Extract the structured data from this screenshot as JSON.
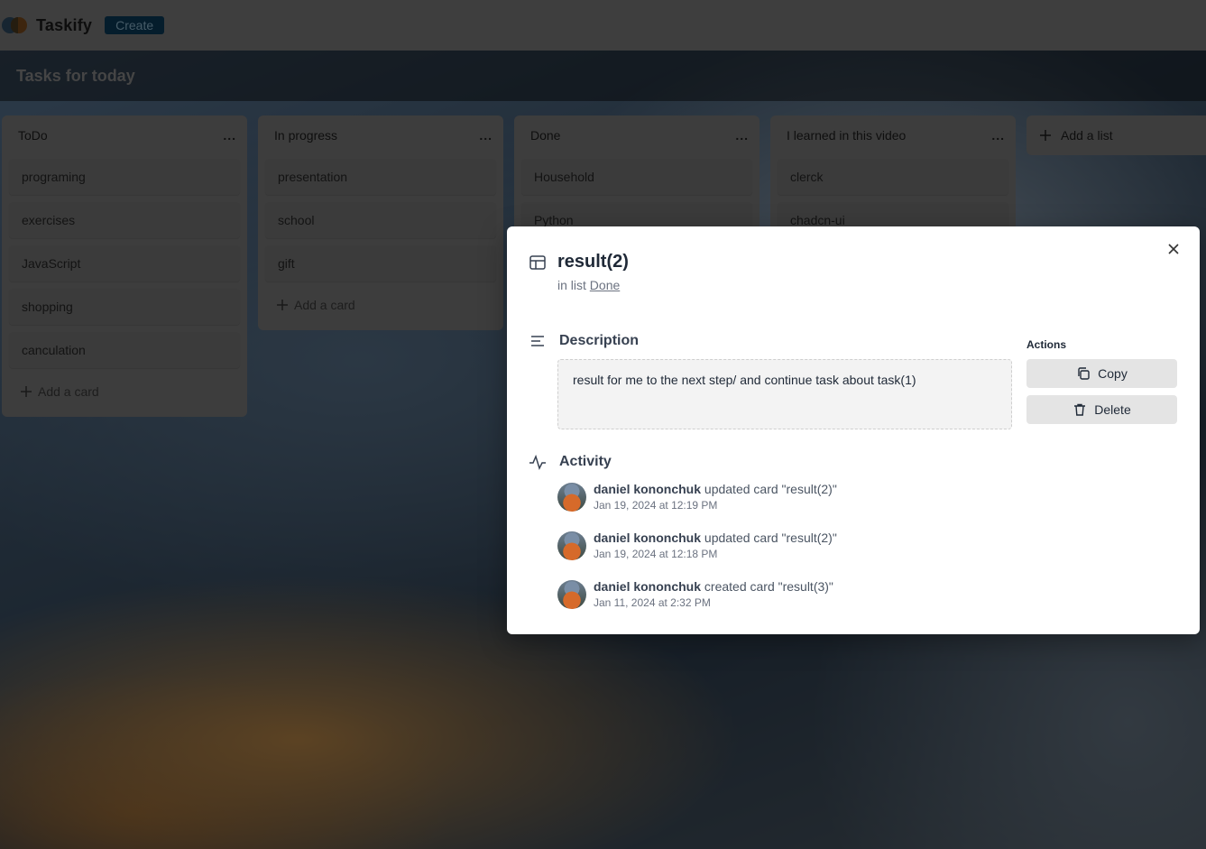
{
  "app": {
    "name": "Taskify",
    "create_label": "Create"
  },
  "board": {
    "title": "Tasks for today"
  },
  "lists": [
    {
      "title": "ToDo",
      "cards": [
        "programing",
        "exercises",
        "JavaScript",
        "shopping",
        "canculation"
      ],
      "add_card": "Add a card"
    },
    {
      "title": "In progress",
      "cards": [
        "presentation",
        "school",
        "gift"
      ],
      "add_card": "Add a card"
    },
    {
      "title": "Done",
      "cards": [
        "Household",
        "Python"
      ]
    },
    {
      "title": "I learned in this video",
      "cards": [
        "clerck",
        "chadcn-ui"
      ]
    }
  ],
  "list_menu_label": "...",
  "add_list_label": "Add a list",
  "modal": {
    "title": "result(2)",
    "in_list_prefix": "in list",
    "list_name": "Done",
    "description_heading": "Description",
    "description_text": "result for me to the next step/ and continue task about task(1)",
    "actions_heading": "Actions",
    "copy_label": "Copy",
    "delete_label": "Delete",
    "activity_heading": "Activity",
    "activity": [
      {
        "user": "daniel kononchuk",
        "action": "updated card \"result(2)\"",
        "time": "Jan 19, 2024 at 12:19 PM"
      },
      {
        "user": "daniel kononchuk",
        "action": "updated card \"result(2)\"",
        "time": "Jan 19, 2024 at 12:18 PM"
      },
      {
        "user": "daniel kononchuk",
        "action": "created card \"result(3)\"",
        "time": "Jan 11, 2024 at 2:32 PM"
      }
    ]
  },
  "colors": {
    "create_button": "#0b3a58",
    "modal_bg": "#ffffff",
    "action_button": "#e4e4e4"
  }
}
